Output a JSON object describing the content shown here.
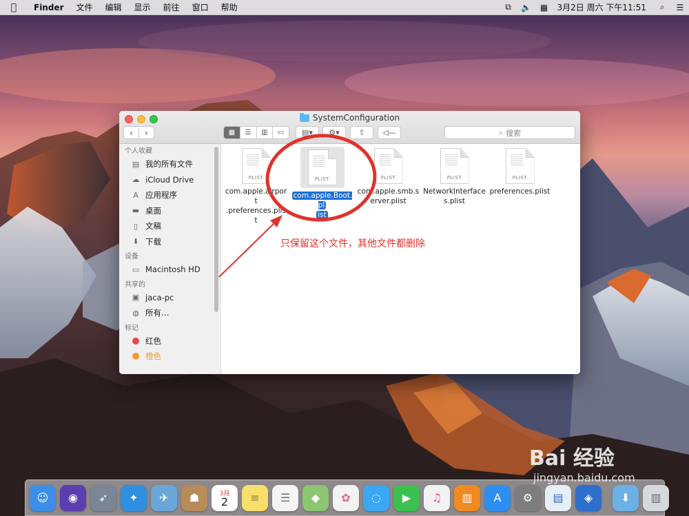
{
  "menubar": {
    "app_name": "Finder",
    "items": [
      "文件",
      "编辑",
      "显示",
      "前往",
      "窗口",
      "帮助"
    ],
    "clock": "3月2日 周六 下午11:51",
    "status_icons": [
      "screen-mirroring-icon",
      "volume-icon",
      "input-method-icon",
      "search-icon",
      "list-icon"
    ]
  },
  "window": {
    "title": "SystemConfiguration",
    "search_placeholder": "搜索",
    "nav": {
      "back": "‹",
      "forward": "›"
    }
  },
  "sidebar": {
    "favorites_heading": "个人收藏",
    "favorites": [
      {
        "label": "我的所有文件",
        "icon": "all-files-icon"
      },
      {
        "label": "iCloud Drive",
        "icon": "cloud-icon"
      },
      {
        "label": "应用程序",
        "icon": "applications-icon"
      },
      {
        "label": "桌面",
        "icon": "desktop-icon"
      },
      {
        "label": "文稿",
        "icon": "documents-icon"
      },
      {
        "label": "下载",
        "icon": "downloads-icon"
      }
    ],
    "devices_heading": "设备",
    "devices": [
      {
        "label": "Macintosh HD",
        "icon": "disk-icon"
      }
    ],
    "shared_heading": "共享的",
    "shared": [
      {
        "label": "jaca-pc",
        "icon": "computer-icon"
      },
      {
        "label": "所有…",
        "icon": "network-icon"
      }
    ],
    "tags_heading": "标记",
    "tags": [
      {
        "label": "红色",
        "color": "#e8484a"
      },
      {
        "label": "橙色",
        "color": "#f39a2b"
      }
    ]
  },
  "files": [
    {
      "name": "com.apple.airport.preferences.plist",
      "display_lines": [
        "com.apple.airport",
        ".preferences.plist"
      ],
      "badge": "PLIST",
      "selected": false
    },
    {
      "name": "com.apple.Boot.plist",
      "display_lines": [
        "com.apple.Boot.pl",
        "ist"
      ],
      "badge": "PLIST",
      "selected": true
    },
    {
      "name": "com.apple.smb.server.plist",
      "display_lines": [
        "com.apple.smb.s",
        "erver.plist"
      ],
      "badge": "PLIST",
      "selected": false
    },
    {
      "name": "NetworkInterfaces.plist",
      "display_lines": [
        "NetworkInterface",
        "s.plist"
      ],
      "badge": "PLIST",
      "selected": false
    },
    {
      "name": "preferences.plist",
      "display_lines": [
        "preferences.plist",
        ""
      ],
      "badge": "PLIST",
      "selected": false
    }
  ],
  "annotation": {
    "text": "只保留这个文件，其他文件都删除",
    "color": "#e0322c"
  },
  "dock": {
    "apps": [
      {
        "name": "finder-icon",
        "color": "#3d8ee6",
        "glyph": "☺"
      },
      {
        "name": "siri-icon",
        "color": "#5b3fae",
        "glyph": "◉"
      },
      {
        "name": "launchpad-icon",
        "color": "#7a8696",
        "glyph": "🚀"
      },
      {
        "name": "safari-icon",
        "color": "#2f8fe0",
        "glyph": "✦"
      },
      {
        "name": "mail-icon",
        "color": "#6aa7d8",
        "glyph": "✈"
      },
      {
        "name": "contacts-icon",
        "color": "#b88c5a",
        "glyph": "☗"
      },
      {
        "name": "calendar-icon",
        "color": "#ffffff",
        "glyph": "2"
      },
      {
        "name": "notes-icon",
        "color": "#f7df6a",
        "glyph": "≡"
      },
      {
        "name": "reminders-icon",
        "color": "#f4f4f4",
        "glyph": "☰"
      },
      {
        "name": "maps-icon",
        "color": "#8cc671",
        "glyph": "◆"
      },
      {
        "name": "photos-icon",
        "color": "#f2f2f2",
        "glyph": "✿"
      },
      {
        "name": "messages-icon",
        "color": "#3aa7f5",
        "glyph": "💬"
      },
      {
        "name": "facetime-icon",
        "color": "#3cc050",
        "glyph": "▶"
      },
      {
        "name": "itunes-icon",
        "color": "#f2f2f2",
        "glyph": "♫"
      },
      {
        "name": "ibooks-icon",
        "color": "#f08a23",
        "glyph": "📖"
      },
      {
        "name": "app-store-icon",
        "color": "#2d8ef0",
        "glyph": "A"
      },
      {
        "name": "system-preferences-icon",
        "color": "#7d7d7d",
        "glyph": "⚙"
      },
      {
        "name": "preview-icon",
        "color": "#e6eef6",
        "glyph": "▤"
      },
      {
        "name": "app-icon",
        "color": "#2e6fce",
        "glyph": "◈"
      }
    ],
    "trailing": [
      {
        "name": "folder-icon",
        "color": "#6bb1e6",
        "glyph": "⬇"
      },
      {
        "name": "trash-icon",
        "color": "#d6d9dc",
        "glyph": "🗑"
      }
    ],
    "calendar_month": "3月",
    "calendar_day": "2"
  },
  "watermark": {
    "main": "Bai 经验",
    "sub": "jingyan.baidu.com"
  }
}
